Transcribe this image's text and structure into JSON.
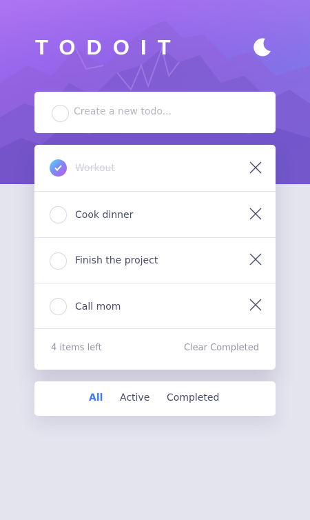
{
  "app": {
    "title": "TODOIT",
    "theme_icon": "moon-icon"
  },
  "colors": {
    "accent": "#3a7cfd",
    "text": "#494c6b",
    "muted": "#9495a5",
    "completed_text": "#d1d2da",
    "check_gradient": [
      "#55ddff",
      "#c058f3"
    ],
    "page_background": "#e4e4ef"
  },
  "new_todo": {
    "placeholder": "Create a new todo..."
  },
  "todos": [
    {
      "label": "Workout",
      "completed": true
    },
    {
      "label": "Cook dinner",
      "completed": false
    },
    {
      "label": "Finish the project",
      "completed": false
    },
    {
      "label": "Call mom",
      "completed": false
    }
  ],
  "footer": {
    "items_left": "4 items left",
    "clear_completed": "Clear Completed"
  },
  "filters": {
    "all": "All",
    "active": "Active",
    "completed": "Completed",
    "selected": "All"
  },
  "icons": {
    "check": "check-icon",
    "remove": "close-icon"
  }
}
